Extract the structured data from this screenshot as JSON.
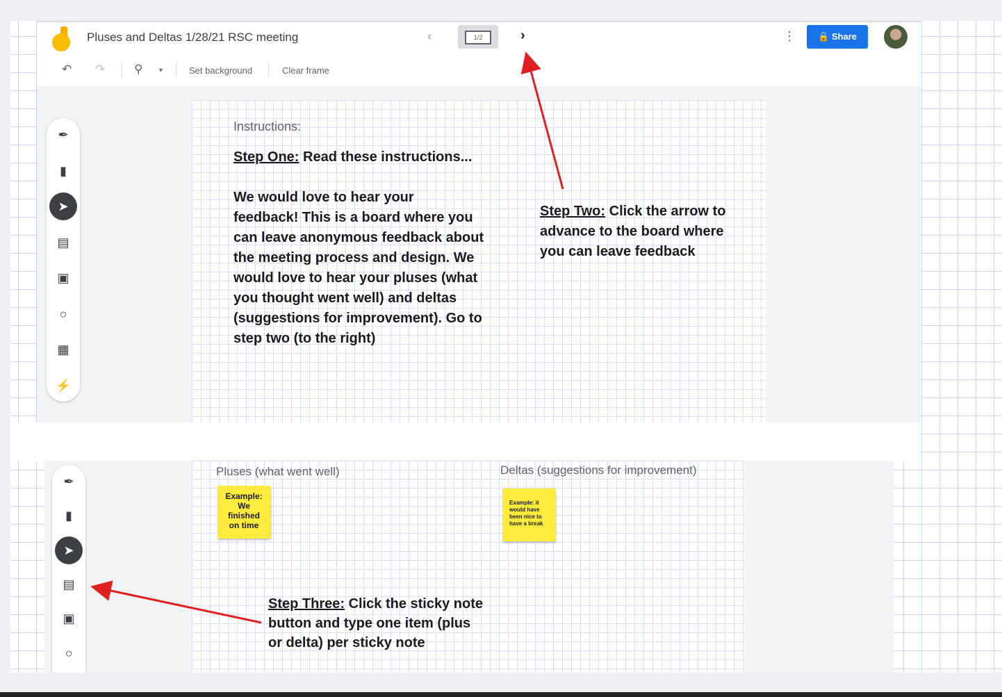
{
  "header": {
    "title": "Pluses and Deltas 1/28/21 RSC meeting",
    "frame_indicator": "1/2",
    "prev_icon": "chevron-left-icon",
    "next_icon": "chevron-right-icon",
    "share_label": "Share"
  },
  "toolbar": {
    "set_background": "Set background",
    "clear_frame": "Clear frame"
  },
  "tools": [
    "pen-icon",
    "eraser-icon",
    "select-icon",
    "sticky-note-icon",
    "image-icon",
    "circle-icon",
    "text-box-icon",
    "laser-icon"
  ],
  "frame1": {
    "instructions_label": "Instructions:",
    "step_one_heading": "Step One:",
    "step_one_text": "Read these instructions...",
    "body_lines": [
      "We would love to hear your",
      "feedback! This is a board where you",
      "can leave anonymous feedback about",
      "the meeting process and design. We",
      "would love to hear your pluses (what",
      "you thought went well) and deltas",
      "(suggestions for improvement). Go to",
      "step two (to the right)"
    ],
    "step_two_heading": "Step Two:",
    "step_two_lines": [
      "Click the arrow to",
      "advance to the board where",
      "you can leave feedback"
    ]
  },
  "frame2": {
    "pluses_label": "Pluses (what went well)",
    "deltas_label": "Deltas (suggestions for improvement)",
    "sticky_plus": [
      "Example:",
      "We",
      "finished",
      "on time"
    ],
    "sticky_delta": [
      "Example: it",
      "would have",
      "been nice to",
      "have a break"
    ],
    "step_three_heading": "Step Three:",
    "step_three_lines": [
      "Click the sticky note",
      "button and type one item (plus",
      "or delta) per sticky note"
    ]
  },
  "colors": {
    "accent": "#1a73e8",
    "sticky": "#ffeb3b",
    "annotation_arrow": "#e02020"
  }
}
